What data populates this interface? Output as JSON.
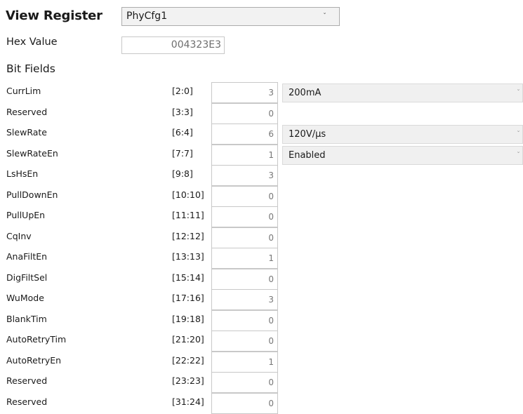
{
  "header": {
    "title": "View Register",
    "register_select": "PhyCfg1",
    "hex_label": "Hex Value",
    "hex_value": "004323E3",
    "bit_fields_label": "Bit Fields"
  },
  "fields": [
    {
      "name": "CurrLim",
      "range": "[2:0]",
      "value": "3",
      "option": "200mA"
    },
    {
      "name": "Reserved",
      "range": "[3:3]",
      "value": "0",
      "option": null
    },
    {
      "name": "SlewRate",
      "range": "[6:4]",
      "value": "6",
      "option": "120V/µs"
    },
    {
      "name": "SlewRateEn",
      "range": "[7:7]",
      "value": "1",
      "option": "Enabled"
    },
    {
      "name": "LsHsEn",
      "range": "[9:8]",
      "value": "3",
      "option": null
    },
    {
      "name": "PullDownEn",
      "range": "[10:10]",
      "value": "0",
      "option": null
    },
    {
      "name": "PullUpEn",
      "range": "[11:11]",
      "value": "0",
      "option": null
    },
    {
      "name": "CqInv",
      "range": "[12:12]",
      "value": "0",
      "option": null
    },
    {
      "name": "AnaFiltEn",
      "range": "[13:13]",
      "value": "1",
      "option": null
    },
    {
      "name": "DigFiltSel",
      "range": "[15:14]",
      "value": "0",
      "option": null
    },
    {
      "name": "WuMode",
      "range": "[17:16]",
      "value": "3",
      "option": null
    },
    {
      "name": "BlankTim",
      "range": "[19:18]",
      "value": "0",
      "option": null
    },
    {
      "name": "AutoRetryTim",
      "range": "[21:20]",
      "value": "0",
      "option": null
    },
    {
      "name": "AutoRetryEn",
      "range": "[22:22]",
      "value": "1",
      "option": null
    },
    {
      "name": "Reserved",
      "range": "[23:23]",
      "value": "0",
      "option": null
    },
    {
      "name": "Reserved",
      "range": "[31:24]",
      "value": "0",
      "option": null
    }
  ],
  "icons": {
    "dropdown": "chevron-down-icon"
  }
}
